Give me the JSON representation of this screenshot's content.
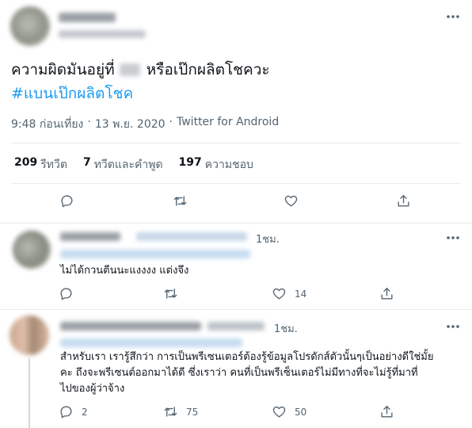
{
  "main_tweet": {
    "text_before": "ความผิดมันอยู่ที่",
    "text_after": "หรือเป๊กผลิตโชควะ",
    "hashtag": "#แบนเป๊กผลิตโชค",
    "time": "9:48 ก่อนเที่ยง",
    "separator": "·",
    "date": "13 พ.ย. 2020",
    "source": "Twitter for Android",
    "stats": {
      "retweets_count": "209",
      "retweets_label": "รีทวีต",
      "quotes_count": "7",
      "quotes_label": "ทวีตและคำพูด",
      "likes_count": "197",
      "likes_label": "ความชอบ"
    }
  },
  "replies": [
    {
      "time": "1ชม.",
      "text": "ไม่ได้กวนตีนนะแงงงง แต่งจึง",
      "actions": {
        "reply": "",
        "retweet": "",
        "like": "14"
      }
    },
    {
      "time": "1ชม.",
      "text_lines": [
        "สำหรับเรา เรารู้สึกว่า การเป็นพรีเซนเตอร์ต้องรู้ข้อมูลโปรดักส์ตัวนั้นๆเป็นอย่างดีใช่มั้ย",
        "คะ ถึงจะพรีเซนต์ออกมาได้ดี ซึ่งเราว่า คนที่เป็นพรีเซ็นเตอร์ไม่มีทางที่จะไม่รู้ที่มาที่",
        "ไปของผู้ว่าจ้าง"
      ],
      "actions": {
        "reply": "2",
        "retweet": "75",
        "like": "50"
      }
    }
  ],
  "colors": {
    "link": "#1d9bf0",
    "text": "#0f1419",
    "muted": "#536471",
    "divider": "#e6ecf0"
  }
}
